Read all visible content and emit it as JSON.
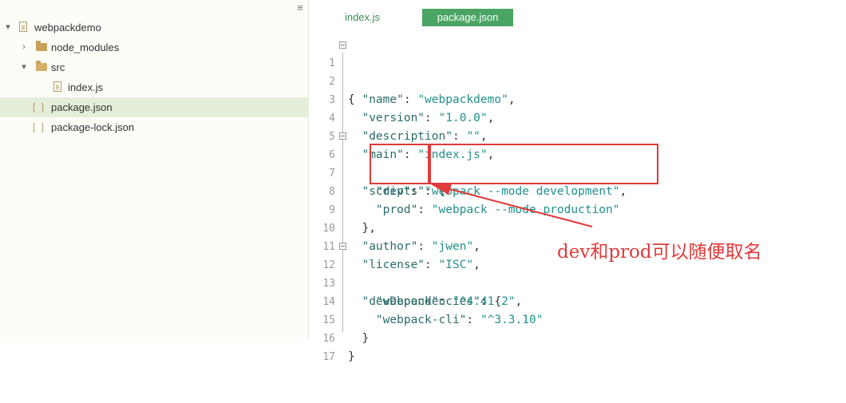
{
  "sidebar": {
    "menu_icon": "menu-icon",
    "items": [
      {
        "label": "webpackdemo",
        "type": "folder",
        "expanded": true,
        "depth": 0
      },
      {
        "label": "node_modules",
        "type": "folder",
        "expanded": false,
        "depth": 1
      },
      {
        "label": "src",
        "type": "folder",
        "expanded": true,
        "depth": 1
      },
      {
        "label": "index.js",
        "type": "file",
        "depth": 2
      },
      {
        "label": "package.json",
        "type": "json",
        "depth": 1,
        "selected": true
      },
      {
        "label": "package-lock.json",
        "type": "json",
        "depth": 1
      }
    ]
  },
  "tabs": [
    {
      "label": "index.js",
      "active": false
    },
    {
      "label": "package.json",
      "active": true
    }
  ],
  "editor": {
    "lines": [
      {
        "n": "1",
        "text": "{"
      },
      {
        "n": "2",
        "text": "  \"name\": \"webpackdemo\","
      },
      {
        "n": "3",
        "text": "  \"version\": \"1.0.0\","
      },
      {
        "n": "4",
        "text": "  \"description\": \"\","
      },
      {
        "n": "5",
        "text": "  \"main\": \"index.js\","
      },
      {
        "n": "6",
        "text": "  \"scripts\": {"
      },
      {
        "n": "7",
        "text": "    \"dev\": \"webpack --mode development\","
      },
      {
        "n": "8",
        "text": "    \"prod\": \"webpack --mode production\""
      },
      {
        "n": "9",
        "text": "  },"
      },
      {
        "n": "10",
        "text": "  \"author\": \"jwen\","
      },
      {
        "n": "11",
        "text": "  \"license\": \"ISC\","
      },
      {
        "n": "12",
        "text": "  \"devDependencies\": {"
      },
      {
        "n": "13",
        "text": "    \"webpack\": \"^4.41.2\","
      },
      {
        "n": "14",
        "text": "    \"webpack-cli\": \"^3.3.10\""
      },
      {
        "n": "15",
        "text": "  }"
      },
      {
        "n": "16",
        "text": "}"
      },
      {
        "n": "17",
        "text": ""
      }
    ]
  },
  "annotation": {
    "text": "dev和prod可以随便取名",
    "color": "#e03a3a"
  },
  "colors": {
    "accent": "#4aa564",
    "selected_row": "#e5eedb",
    "key": "#2b6b6b",
    "string": "#22908b"
  }
}
